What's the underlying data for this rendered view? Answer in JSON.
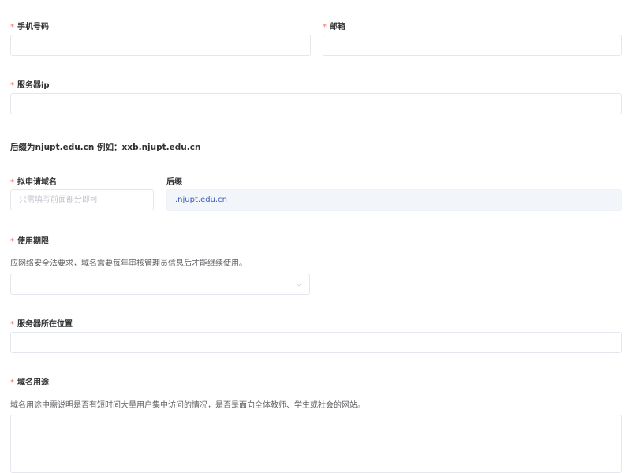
{
  "form": {
    "required_mark": "*",
    "phone": {
      "label": "手机号码",
      "value": "",
      "placeholder": ""
    },
    "email": {
      "label": "邮箱",
      "value": "",
      "placeholder": ""
    },
    "server_ip": {
      "label": "服务器ip",
      "value": "",
      "placeholder": ""
    },
    "suffix_note": "后缀为njupt.edu.cn 例如：xxb.njupt.edu.cn",
    "domain_name": {
      "label": "拟申请域名",
      "value": "",
      "placeholder": "只需填写前面部分即可"
    },
    "suffix": {
      "label": "后缀",
      "value": ".njupt.edu.cn"
    },
    "usage_period": {
      "label": "使用期限",
      "hint": "应网络安全法要求，域名需要每年审核管理员信息后才能继续使用。",
      "selected": ""
    },
    "server_location": {
      "label": "服务器所在位置",
      "value": "",
      "placeholder": ""
    },
    "domain_purpose": {
      "label": "域名用途",
      "hint": "域名用途中需说明是否有短时间大量用户集中访问的情况，是否是面向全体教师、学生或社会的网站。",
      "value": "",
      "placeholder": ""
    }
  },
  "icons": {
    "select_arrow": "chevron-down-icon"
  },
  "colors": {
    "required": "#f56c6c",
    "suffix_text": "#3b5bb8",
    "suffix_bg": "#f2f5fa",
    "border": "#e4e7ed"
  }
}
